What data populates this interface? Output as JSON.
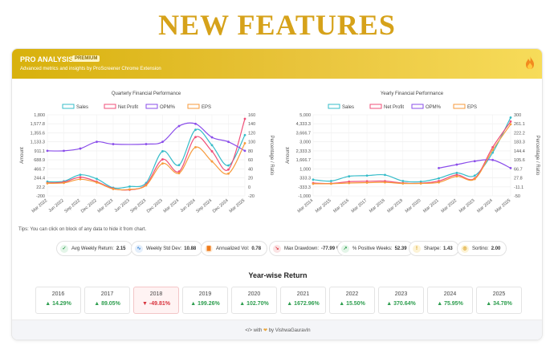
{
  "page": {
    "headline": "NEW FEATURES"
  },
  "banner": {
    "title": "PRO ANALYSIS",
    "badge": "PREMIUM",
    "subtitle": "Advanced metrics and insights by ProScreener Chrome Extension",
    "icon": "flame-icon",
    "colors": {
      "start": "#d8b10c",
      "end": "#f7dc5a"
    }
  },
  "tips": "Tips: You can click on block of any data to hide it from chart.",
  "chart_data": [
    {
      "type": "line",
      "title": "Quarterly Financial Performance",
      "ylabel": "Amount",
      "y2label": "Percentage / Ratio",
      "yticks": [
        "1,800",
        "1,577.8",
        "1,355.6",
        "1,133.3",
        "911.1",
        "688.9",
        "466.7",
        "244.4",
        "22.2",
        "-200"
      ],
      "y2ticks": [
        "160",
        "140",
        "120",
        "100",
        "80",
        "60",
        "40",
        "20",
        "0",
        "-20"
      ],
      "ylim": [
        -200,
        1800
      ],
      "y2lim": [
        -20,
        160
      ],
      "xlabels": [
        "Mar 2022",
        "Jun 2022",
        "Sep 2022",
        "Dec 2022",
        "Mar 2023",
        "Jun 2023",
        "Sep 2023",
        "Dec 2023",
        "Mar 2024",
        "Jun 2024",
        "Sep 2024",
        "Dec 2024",
        "Mar 2025"
      ],
      "legend": [
        "Sales",
        "Net Profit",
        "OPM%",
        "EPS"
      ],
      "legend_position": "top",
      "grid": true,
      "series": [
        {
          "name": "Sales",
          "axis": "left",
          "color": "#36bcc9",
          "values": [
            150,
            160,
            320,
            220,
            0,
            30,
            120,
            900,
            560,
            1430,
            1050,
            550,
            1300
          ]
        },
        {
          "name": "Net Profit",
          "axis": "left",
          "color": "#f04f78",
          "values": [
            120,
            140,
            260,
            150,
            -20,
            -50,
            80,
            700,
            400,
            1250,
            900,
            450,
            1700
          ]
        },
        {
          "name": "OPM%",
          "axis": "right",
          "color": "#8a4dea",
          "values": [
            80,
            80,
            85,
            100,
            95,
            null,
            95,
            100,
            135,
            140,
            110,
            100,
            80
          ]
        },
        {
          "name": "EPS",
          "axis": "left",
          "color": "#f79a3b",
          "values": [
            110,
            120,
            210,
            130,
            -30,
            -40,
            60,
            600,
            360,
            1000,
            650,
            350,
            1100
          ]
        }
      ]
    },
    {
      "type": "line",
      "title": "Yearly Financial Performance",
      "ylabel": "Amount",
      "y2label": "Percentage / Ratio",
      "yticks": [
        "5,000",
        "4,333.3",
        "3,666.7",
        "3,000",
        "2,333.3",
        "1,666.7",
        "1,000",
        "333.3",
        "-333.3",
        "-1,000"
      ],
      "y2ticks": [
        "300",
        "261.1",
        "222.2",
        "183.3",
        "144.4",
        "105.6",
        "66.7",
        "27.8",
        "-11.1",
        "-50"
      ],
      "ylim": [
        -1000,
        5000
      ],
      "y2lim": [
        -50,
        300
      ],
      "xlabels": [
        "Mar 2014",
        "Mar 2015",
        "Mar 2016",
        "Mar 2017",
        "Mar 2018",
        "Mar 2019",
        "Mar 2020",
        "Mar 2021",
        "Mar 2022",
        "Mar 2023",
        "Mar 2024",
        "Mar 2025"
      ],
      "legend": [
        "Sales",
        "Net Profit",
        "OPM%",
        "EPS"
      ],
      "legend_position": "top",
      "grid": true,
      "series": [
        {
          "name": "Sales",
          "axis": "left",
          "color": "#36bcc9",
          "values": [
            200,
            100,
            450,
            500,
            550,
            100,
            50,
            300,
            700,
            500,
            2200,
            4800
          ]
        },
        {
          "name": "Net Profit",
          "axis": "left",
          "color": "#f04f78",
          "values": [
            -50,
            -80,
            50,
            80,
            90,
            -50,
            -60,
            100,
            550,
            300,
            2600,
            4500
          ]
        },
        {
          "name": "OPM%",
          "axis": "right",
          "color": "#8a4dea",
          "values": [
            null,
            null,
            null,
            null,
            null,
            null,
            null,
            70,
            85,
            100,
            105,
            70
          ]
        },
        {
          "name": "EPS",
          "axis": "left",
          "color": "#f79a3b",
          "values": [
            -100,
            -100,
            -50,
            -20,
            0,
            -80,
            -80,
            0,
            450,
            250,
            2400,
            4300
          ]
        }
      ]
    }
  ],
  "metrics": [
    {
      "label": "Avg Weekly Return:",
      "value": "2.15",
      "icon": "check-circle-icon",
      "color": "#2e9e4f",
      "bg": "#e3f5e8"
    },
    {
      "label": "Weekly Std Dev:",
      "value": "10.88",
      "icon": "wave-icon",
      "color": "#2f7fd6",
      "bg": "#e3eefb"
    },
    {
      "label": "Annualized Vol:",
      "value": "0.78",
      "icon": "bar-chart-icon",
      "color": "#ef7a1a",
      "bg": "#fdeedd"
    },
    {
      "label": "Max Drawdown:",
      "value": "-77.99 %",
      "icon": "trend-down-icon",
      "color": "#e0454f",
      "bg": "#fbe3e4"
    },
    {
      "label": "% Positive Weeks:",
      "value": "52.39",
      "icon": "trend-up-icon",
      "color": "#2e9e4f",
      "bg": "#e3f5e8"
    },
    {
      "label": "Sharpe:",
      "value": "1.43",
      "icon": "warning-icon",
      "color": "#d79a10",
      "bg": "#fdf3d6"
    },
    {
      "label": "Sortino:",
      "value": "2.00",
      "icon": "target-icon",
      "color": "#d79a10",
      "bg": "#fdf3d6"
    }
  ],
  "yearwise": {
    "title": "Year-wise Return",
    "items": [
      {
        "year": "2016",
        "ret": "14.29%",
        "up": true
      },
      {
        "year": "2017",
        "ret": "89.05%",
        "up": true
      },
      {
        "year": "2018",
        "ret": "-49.81%",
        "up": false
      },
      {
        "year": "2019",
        "ret": "199.26%",
        "up": true
      },
      {
        "year": "2020",
        "ret": "102.70%",
        "up": true
      },
      {
        "year": "2021",
        "ret": "1672.96%",
        "up": true
      },
      {
        "year": "2022",
        "ret": "15.50%",
        "up": true
      },
      {
        "year": "2023",
        "ret": "370.64%",
        "up": true
      },
      {
        "year": "2024",
        "ret": "75.95%",
        "up": true
      },
      {
        "year": "2025",
        "ret": "34.78%",
        "up": true
      }
    ],
    "colors": {
      "up": "#2e9e4f",
      "down": "#d8333d",
      "down_bg": "#fff3f3",
      "down_border": "#f3c6c8"
    }
  },
  "footer": {
    "prefix": "</> with",
    "by": "by",
    "author": "VishwaGauravIn",
    "icon": "heart-icon"
  }
}
